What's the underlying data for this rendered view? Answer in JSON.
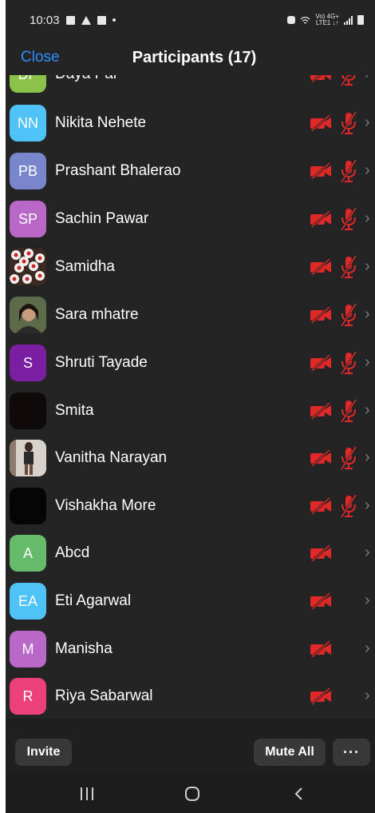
{
  "status_bar": {
    "time": "10:03",
    "net_top": "Vo) 4G+",
    "net_bottom": "LTE1 ↓↑"
  },
  "header": {
    "close_label": "Close",
    "title": "Participants (17)"
  },
  "participants": [
    {
      "initials": "DP",
      "name": "Daya Pal",
      "color": "#8bc34a",
      "camera_off": true,
      "mic_muted": true,
      "partial": true
    },
    {
      "initials": "NN",
      "name": "Nikita Nehete",
      "color": "#4fc3f7",
      "camera_off": true,
      "mic_muted": true
    },
    {
      "initials": "PB",
      "name": "Prashant Bhalerao",
      "color": "#7986cb",
      "camera_off": true,
      "mic_muted": true
    },
    {
      "initials": "SP",
      "name": "Sachin Pawar",
      "color": "#ba68c8",
      "camera_off": true,
      "mic_muted": true
    },
    {
      "initials": "",
      "name": "Samidha",
      "color": "#c62828",
      "photo": "flowers",
      "camera_off": true,
      "mic_muted": true
    },
    {
      "initials": "",
      "name": "Sara mhatre",
      "color": "#4a5a3a",
      "photo": "portrait",
      "camera_off": true,
      "mic_muted": true
    },
    {
      "initials": "S",
      "name": "Shruti Tayade",
      "color": "#7b1fa2",
      "camera_off": true,
      "mic_muted": true
    },
    {
      "initials": "",
      "name": "Smita",
      "color": "#0e0a0a",
      "camera_off": true,
      "mic_muted": true
    },
    {
      "initials": "",
      "name": "Vanitha Narayan",
      "color": "#c9c1bc",
      "photo": "standing",
      "camera_off": true,
      "mic_muted": true
    },
    {
      "initials": "",
      "name": "Vishakha More",
      "color": "#050505",
      "camera_off": true,
      "mic_muted": true
    },
    {
      "initials": "A",
      "name": "Abcd",
      "color": "#66bb6a",
      "camera_off": true,
      "mic_muted": false
    },
    {
      "initials": "EA",
      "name": "Eti Agarwal",
      "color": "#4fc3f7",
      "camera_off": true,
      "mic_muted": false
    },
    {
      "initials": "M",
      "name": "Manisha",
      "color": "#ba68c8",
      "camera_off": true,
      "mic_muted": false
    },
    {
      "initials": "R",
      "name": "Riya Sabarwal",
      "color": "#ec407a",
      "camera_off": true,
      "mic_muted": false
    }
  ],
  "bottom_bar": {
    "invite_label": "Invite",
    "mute_all_label": "Mute All",
    "more_label": "···"
  },
  "icons": {
    "camera": "camera-off-icon",
    "mic": "mic-muted-icon",
    "chevron": "chevron-right-icon"
  },
  "colors": {
    "accent": "#2d8cff",
    "muted_red": "#e02828",
    "background": "#242424"
  }
}
